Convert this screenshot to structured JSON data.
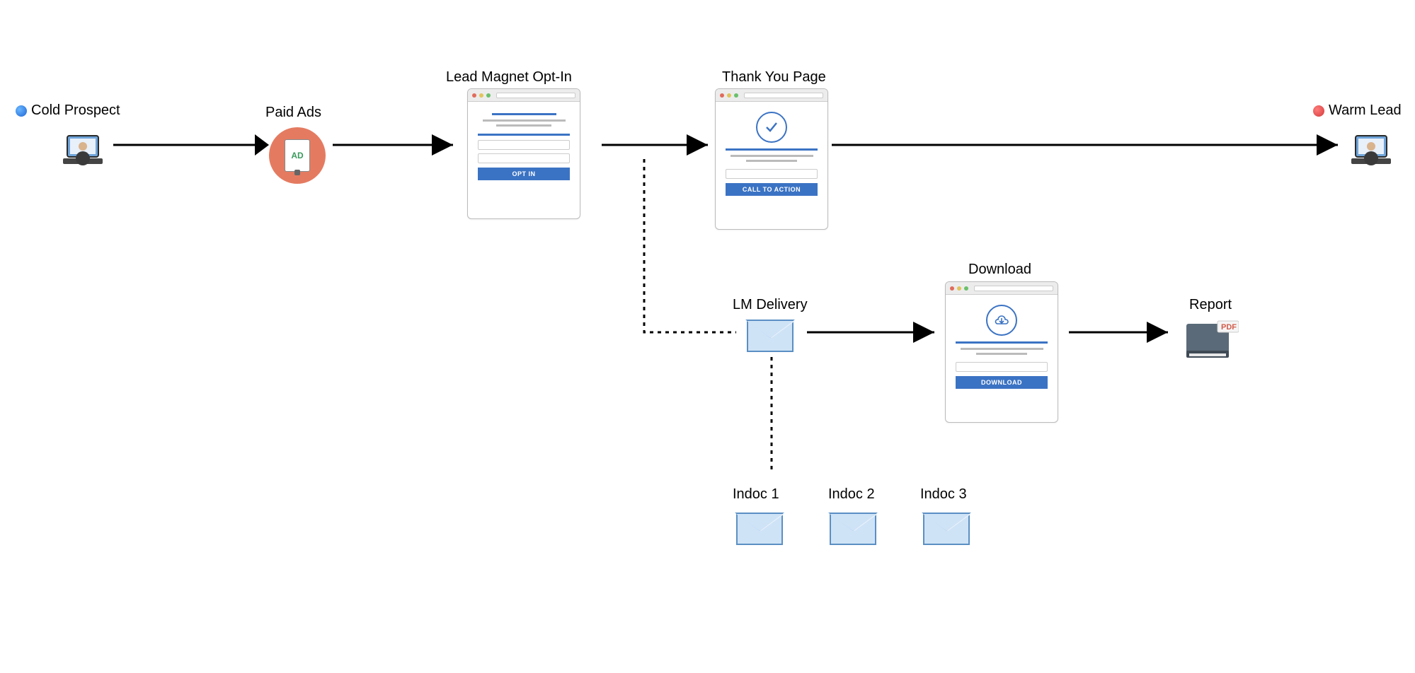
{
  "nodes": {
    "cold_prospect": {
      "label": "Cold Prospect",
      "indicator_color": "#1e66d6"
    },
    "paid_ads": {
      "label": "Paid Ads",
      "ad_text": "AD"
    },
    "lead_magnet": {
      "label": "Lead Magnet Opt-In",
      "button": "OPT IN"
    },
    "thank_you": {
      "label": "Thank You Page",
      "button": "CALL TO ACTION"
    },
    "warm_lead": {
      "label": "Warm Lead",
      "indicator_color": "#d43a3a"
    },
    "lm_delivery": {
      "label": "LM Delivery"
    },
    "download": {
      "label": "Download",
      "button": "DOWNLOAD"
    },
    "report": {
      "label": "Report",
      "badge": "PDF"
    },
    "indoc": [
      {
        "label": "Indoc 1"
      },
      {
        "label": "Indoc 2"
      },
      {
        "label": "Indoc 3"
      }
    ]
  },
  "flow": {
    "solid_edges": [
      [
        "cold_prospect",
        "paid_ads"
      ],
      [
        "paid_ads",
        "lead_magnet"
      ],
      [
        "lead_magnet",
        "thank_you"
      ],
      [
        "thank_you",
        "warm_lead"
      ],
      [
        "lm_delivery",
        "download"
      ],
      [
        "download",
        "report"
      ]
    ],
    "dotted_edges": [
      [
        "lead_magnet",
        "lm_delivery"
      ],
      [
        "lm_delivery",
        "indoc"
      ]
    ]
  }
}
